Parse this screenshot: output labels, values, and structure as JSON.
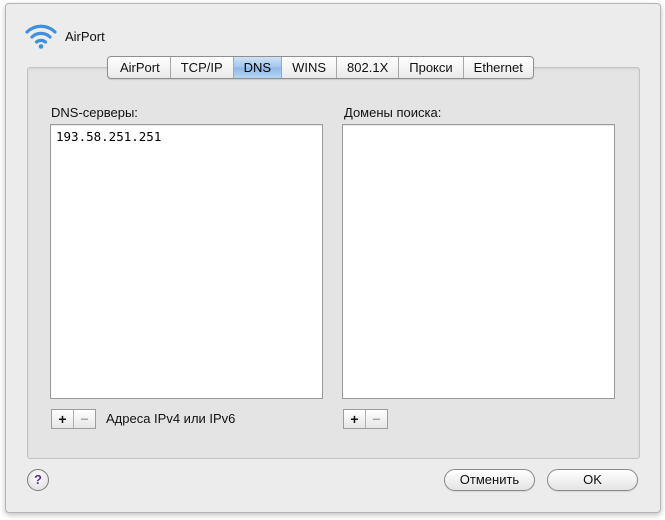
{
  "header": {
    "title": "AirPort",
    "icon": "wifi-icon"
  },
  "tabs": [
    {
      "label": "AirPort",
      "active": false
    },
    {
      "label": "TCP/IP",
      "active": false
    },
    {
      "label": "DNS",
      "active": true
    },
    {
      "label": "WINS",
      "active": false
    },
    {
      "label": "802.1X",
      "active": false
    },
    {
      "label": "Прокси",
      "active": false
    },
    {
      "label": "Ethernet",
      "active": false
    }
  ],
  "dns_servers": {
    "label": "DNS-серверы:",
    "items": [
      "193.58.251.251"
    ],
    "add_label": "+",
    "remove_label": "−",
    "hint": "Адреса IPv4 или IPv6"
  },
  "search_domains": {
    "label": "Домены поиска:",
    "items": [],
    "add_label": "+",
    "remove_label": "−"
  },
  "footer": {
    "help_label": "?",
    "cancel_label": "Отменить",
    "ok_label": "OK"
  },
  "colors": {
    "active_tab": "#9fc6ec",
    "panel_bg": "#ececec"
  }
}
